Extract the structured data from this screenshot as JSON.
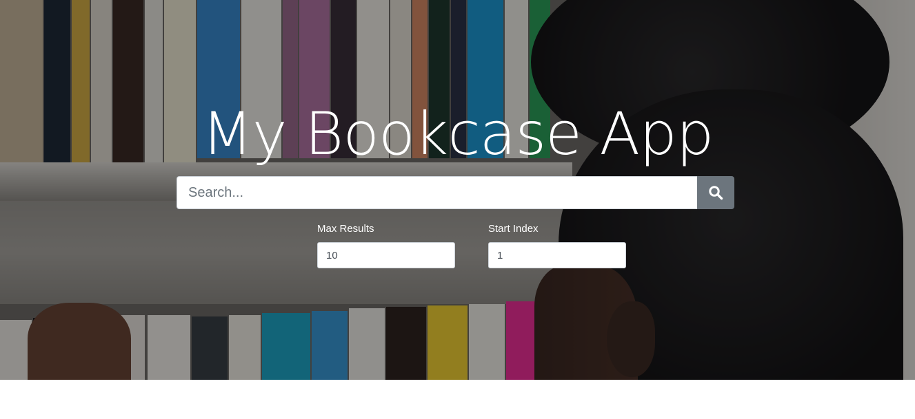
{
  "hero": {
    "title": "My Bookcase App"
  },
  "search": {
    "placeholder": "Search...",
    "value": "",
    "button_icon": "search-icon"
  },
  "options": {
    "max_results": {
      "label": "Max Results",
      "value": "10"
    },
    "start_index": {
      "label": "Start Index",
      "value": "1"
    }
  },
  "colors": {
    "search_button": "#6c757d",
    "text_on_hero": "#ffffff",
    "page_background": "#ffffff"
  }
}
